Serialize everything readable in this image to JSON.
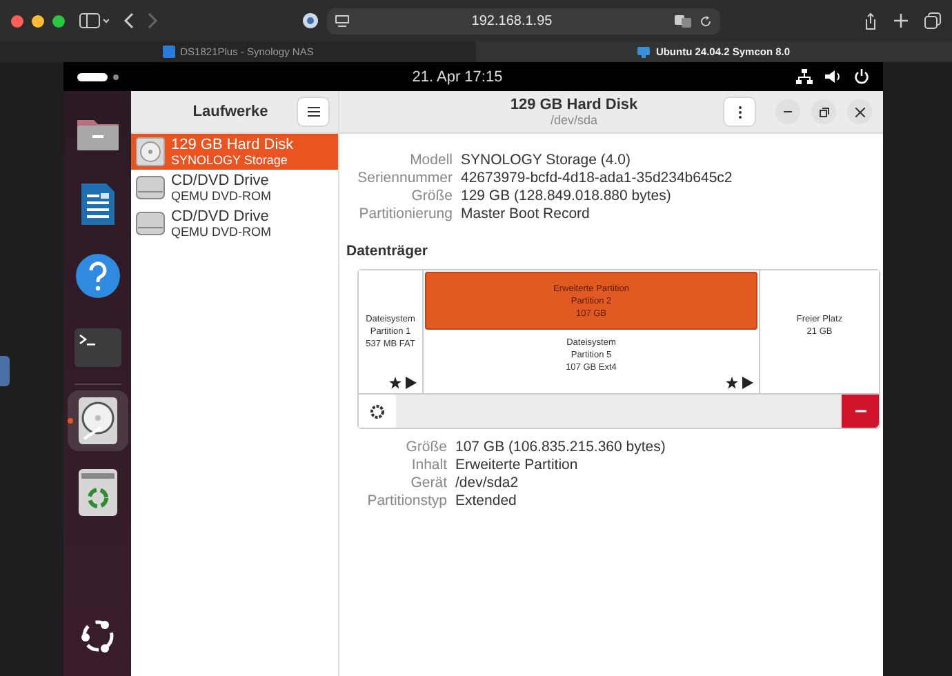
{
  "browser": {
    "address": "192.168.1.95",
    "tabs": [
      {
        "label": "DS1821Plus - Synology NAS",
        "selected": false,
        "kind": "dsm"
      },
      {
        "label": "Ubuntu 24.04.2 Symcon 8.0",
        "selected": true,
        "kind": "screen"
      }
    ]
  },
  "topbar": {
    "clock": "21. Apr  17:15"
  },
  "dock": [
    {
      "kind": "files",
      "selected": false
    },
    {
      "kind": "writer",
      "selected": false
    },
    {
      "kind": "help",
      "selected": false
    },
    {
      "kind": "terminal",
      "selected": false
    },
    {
      "kind": "disks",
      "selected": true
    },
    {
      "kind": "trash",
      "selected": false
    }
  ],
  "sidebar": {
    "title": "Laufwerke",
    "drives": [
      {
        "name": "129 GB Hard Disk",
        "sub": "SYNOLOGY Storage",
        "kind": "hdd",
        "selected": true
      },
      {
        "name": "CD/DVD Drive",
        "sub": "QEMU DVD-ROM",
        "kind": "optical",
        "selected": false
      },
      {
        "name": "CD/DVD Drive",
        "sub": "QEMU DVD-ROM",
        "kind": "optical",
        "selected": false
      }
    ]
  },
  "header": {
    "title": "129 GB Hard Disk",
    "subtitle": "/dev/sda"
  },
  "info": [
    {
      "label": "Modell",
      "value": "SYNOLOGY Storage (4.0)"
    },
    {
      "label": "Seriennummer",
      "value": "42673979-bcfd-4d18-ada1-35d234b645c2"
    },
    {
      "label": "Größe",
      "value": "129 GB (128.849.018.880 bytes)"
    },
    {
      "label": "Partitionierung",
      "value": "Master Boot Record"
    }
  ],
  "volumes_heading": "Datenträger",
  "volumes": [
    {
      "kind": "fs",
      "lines": [
        "Dateisystem",
        "Partition 1",
        "537 MB FAT"
      ],
      "selected": false
    },
    {
      "kind": "extended",
      "lines": [
        "Erweiterte Partition",
        "Partition 2",
        "107 GB"
      ],
      "selected": true,
      "children": [
        {
          "kind": "fs",
          "lines": [
            "Dateisystem",
            "Partition 5",
            "107 GB Ext4"
          ],
          "selected": false
        }
      ]
    },
    {
      "kind": "free",
      "lines": [
        "Freier Platz",
        "21 GB"
      ],
      "selected": false
    }
  ],
  "details": [
    {
      "label": "Größe",
      "value": "107 GB (106.835.215.360 bytes)"
    },
    {
      "label": "Inhalt",
      "value": "Erweiterte Partition"
    },
    {
      "label": "Gerät",
      "value": "/dev/sda2"
    },
    {
      "label": "Partitionstyp",
      "value": "Extended"
    }
  ]
}
